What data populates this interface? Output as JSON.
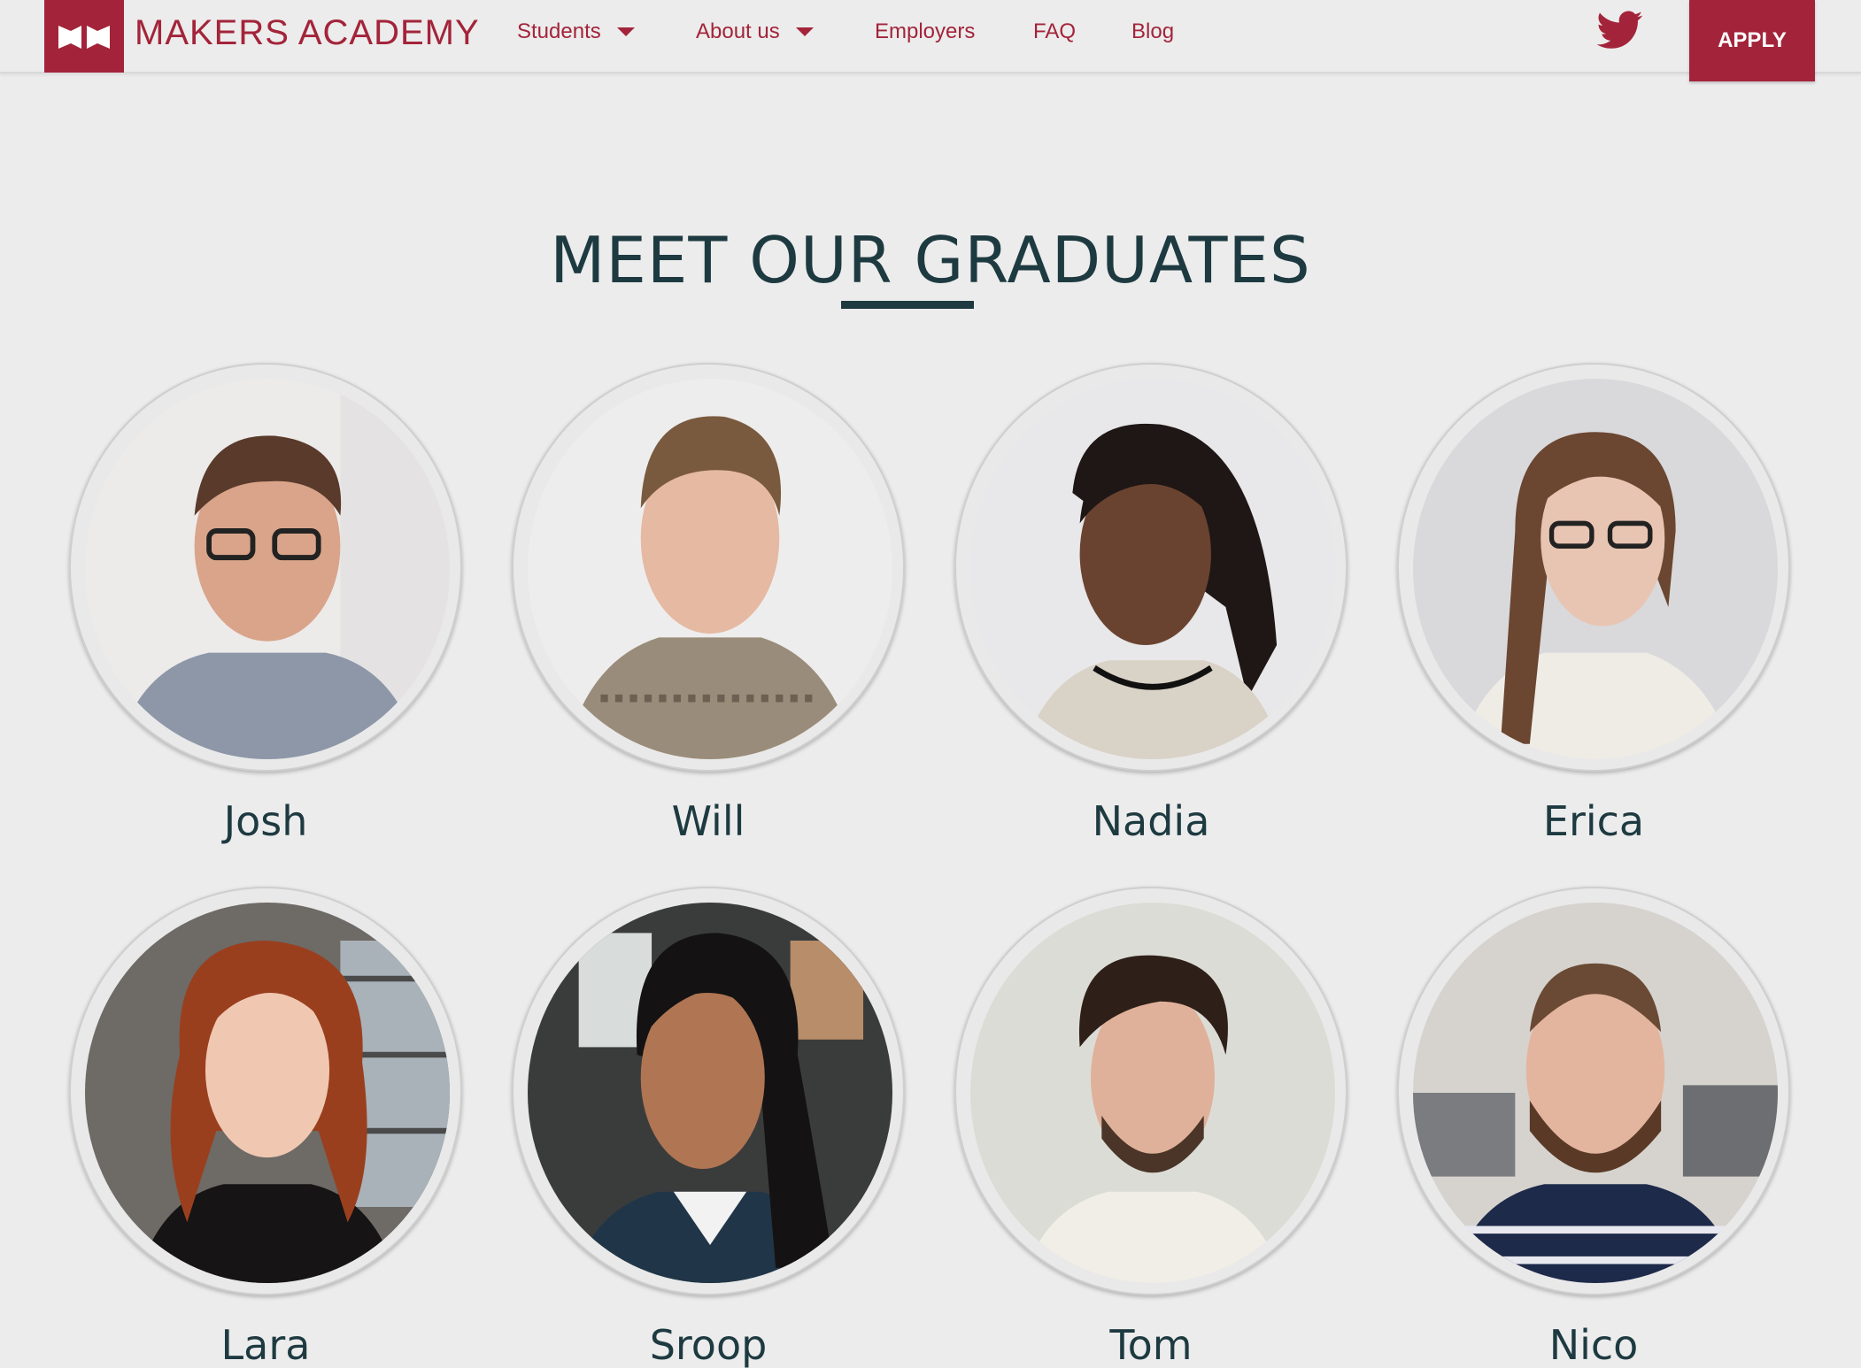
{
  "header": {
    "logo_text": "MAKERS ACADEMY",
    "nav": [
      {
        "label": "Students",
        "dropdown": true
      },
      {
        "label": "About us",
        "dropdown": true
      },
      {
        "label": "Employers",
        "dropdown": false
      },
      {
        "label": "FAQ",
        "dropdown": false
      },
      {
        "label": "Blog",
        "dropdown": false
      }
    ],
    "apply_label": "APPLY",
    "twitter_icon": "twitter-icon"
  },
  "main": {
    "title": "MEET OUR GRADUATES",
    "graduates": [
      {
        "name": "Josh"
      },
      {
        "name": "Will"
      },
      {
        "name": "Nadia"
      },
      {
        "name": "Erica"
      },
      {
        "name": "Lara"
      },
      {
        "name": "Sroop"
      },
      {
        "name": "Tom"
      },
      {
        "name": "Nico"
      }
    ]
  },
  "colors": {
    "brand": "#a3243a",
    "heading": "#1e3a41",
    "background": "#ececec"
  }
}
